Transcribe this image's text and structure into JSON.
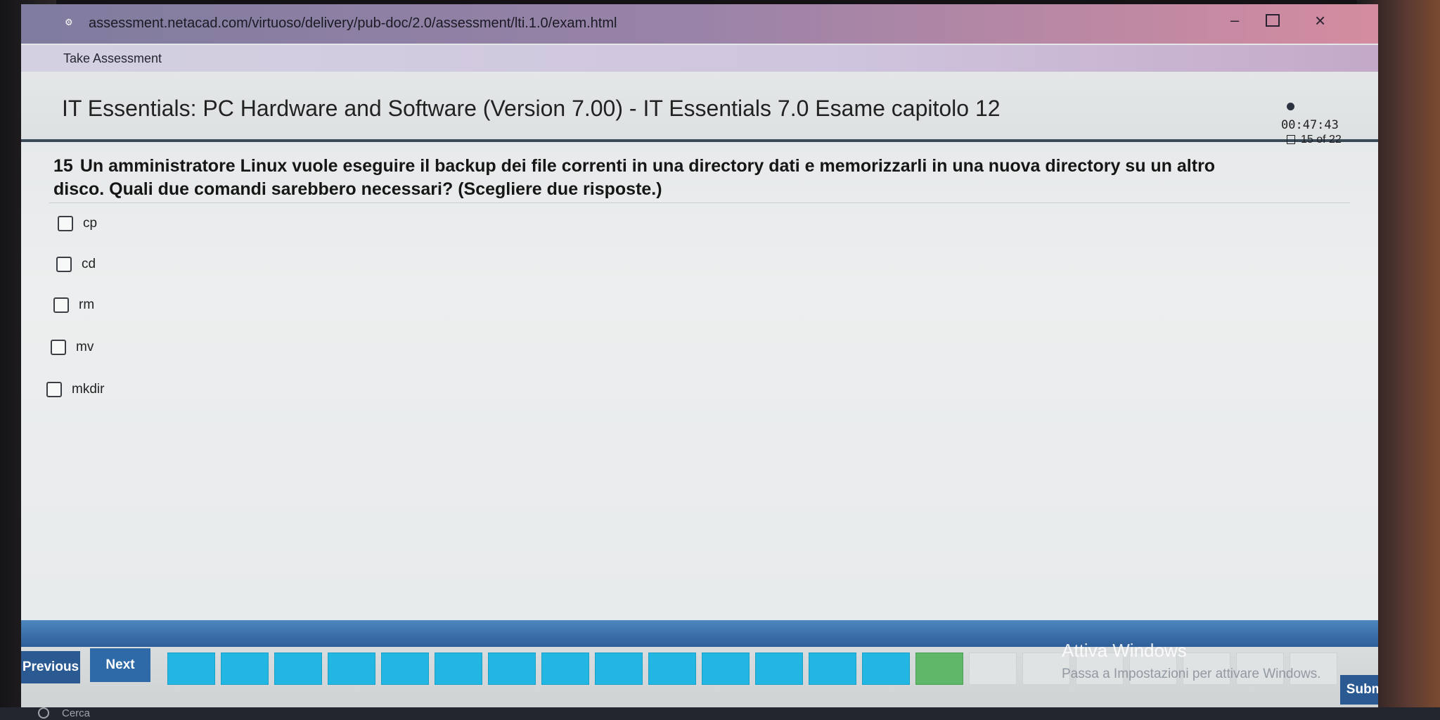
{
  "browser": {
    "url": "assessment.netacad.com/virtuoso/delivery/pub-doc/2.0/assessment/lti.1.0/exam.html"
  },
  "app": {
    "title": "Take Assessment"
  },
  "exam": {
    "title": "IT Essentials: PC Hardware and Software (Version 7.00) - IT Essentials 7.0 Esame capitolo 12",
    "timer": "00:47:43",
    "question_counter": "15 of 22"
  },
  "question": {
    "number": "15",
    "text": "Un amministratore Linux vuole eseguire il backup dei file correnti in una directory dati e memorizzarli in una nuova directory su un altro disco. Quali due comandi sarebbero necessari? (Scegliere due risposte.)",
    "options": [
      {
        "label": "cp",
        "checked": false
      },
      {
        "label": "cd",
        "checked": false
      },
      {
        "label": "rm",
        "checked": false
      },
      {
        "label": "mv",
        "checked": false
      },
      {
        "label": "mkdir",
        "checked": false
      }
    ]
  },
  "navigation": {
    "previous_label": "Previous",
    "next_label": "Next",
    "submit_label": "Submit",
    "question_states": [
      "answered",
      "answered",
      "answered",
      "answered",
      "answered",
      "answered",
      "answered",
      "answered",
      "answered",
      "answered",
      "answered",
      "answered",
      "answered",
      "answered",
      "current",
      "empty",
      "empty",
      "empty",
      "empty",
      "empty",
      "empty",
      "empty"
    ]
  },
  "os": {
    "activation_title": "Attiva Windows",
    "activation_subtitle": "Passa a Impostazioni per attivare Windows.",
    "taskbar_search": "Cerca"
  },
  "colors": {
    "answered": "#22b6e2",
    "current": "#5fb86a",
    "nav_blue": "#2b5a92"
  }
}
